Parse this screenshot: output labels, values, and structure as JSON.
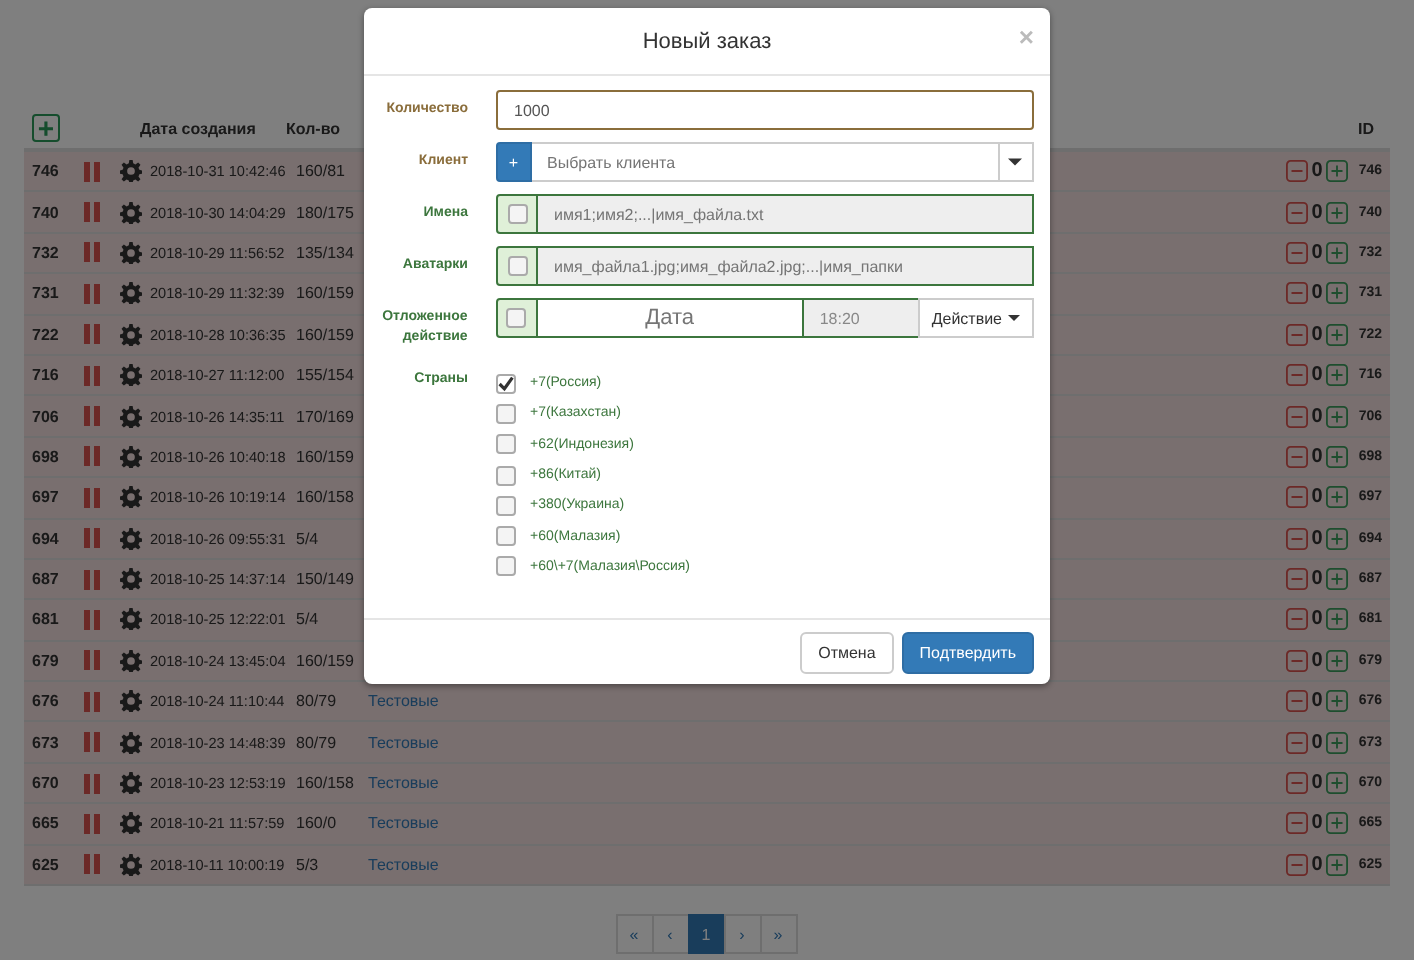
{
  "table": {
    "add_button": "+",
    "columns": [
      "Дата создания",
      "Кол-во",
      "ID"
    ],
    "rows": [
      {
        "number": "746",
        "date": "2018-10-31 10:42:46",
        "count": "160/81",
        "counter": "0",
        "id": "746"
      },
      {
        "number": "740",
        "date": "2018-10-30 14:04:29",
        "count": "180/175",
        "counter": "0",
        "id": "740"
      },
      {
        "number": "732",
        "date": "2018-10-29 11:56:52",
        "count": "135/134",
        "counter": "0",
        "id": "732"
      },
      {
        "number": "731",
        "date": "2018-10-29 11:32:39",
        "count": "160/159",
        "counter": "0",
        "id": "731"
      },
      {
        "number": "722",
        "date": "2018-10-28 10:36:35",
        "count": "160/159",
        "counter": "0",
        "id": "722"
      },
      {
        "number": "716",
        "date": "2018-10-27 11:12:00",
        "count": "155/154",
        "counter": "0",
        "id": "716"
      },
      {
        "number": "706",
        "date": "2018-10-26 14:35:11",
        "count": "170/169",
        "counter": "0",
        "id": "706"
      },
      {
        "number": "698",
        "date": "2018-10-26 10:40:18",
        "count": "160/159",
        "counter": "0",
        "id": "698"
      },
      {
        "number": "697",
        "date": "2018-10-26 10:19:14",
        "count": "160/158",
        "counter": "0",
        "id": "697"
      },
      {
        "number": "694",
        "date": "2018-10-26 09:55:31",
        "count": "5/4",
        "counter": "0",
        "id": "694"
      },
      {
        "number": "687",
        "date": "2018-10-25 14:37:14",
        "count": "150/149",
        "counter": "0",
        "id": "687"
      },
      {
        "number": "681",
        "date": "2018-10-25 12:22:01",
        "count": "5/4",
        "counter": "0",
        "id": "681"
      },
      {
        "number": "679",
        "date": "2018-10-24 13:45:04",
        "count": "160/159",
        "counter": "0",
        "id": "679"
      },
      {
        "number": "676",
        "date": "2018-10-24 11:10:44",
        "count": "80/79",
        "group": "Тестовые",
        "counter": "0",
        "id": "676"
      },
      {
        "number": "673",
        "date": "2018-10-23 14:48:39",
        "count": "80/79",
        "group": "Тестовые",
        "counter": "0",
        "id": "673"
      },
      {
        "number": "670",
        "date": "2018-10-23 12:53:19",
        "count": "160/158",
        "group": "Тестовые",
        "counter": "0",
        "id": "670"
      },
      {
        "number": "665",
        "date": "2018-10-21 11:57:59",
        "count": "160/0",
        "group": "Тестовые",
        "counter": "0",
        "id": "665"
      },
      {
        "number": "625",
        "date": "2018-10-11 10:00:19",
        "count": "5/3",
        "group": "Тестовые",
        "counter": "0",
        "id": "625"
      }
    ]
  },
  "pagination": [
    {
      "label": "«",
      "selected": false
    },
    {
      "label": "‹",
      "selected": false
    },
    {
      "label": "1",
      "selected": true
    },
    {
      "label": "›",
      "selected": false
    },
    {
      "label": "»",
      "selected": false
    }
  ],
  "modal": {
    "title": "Новый заказ",
    "close": "×",
    "fields": [
      {
        "kind": "text",
        "label": "Количество",
        "value": "1000"
      },
      {
        "kind": "client",
        "label": "Клиент",
        "button": "+",
        "placeholder": "Выбрать клиента"
      },
      {
        "kind": "check_input",
        "label": "Имена",
        "checked": false,
        "placeholder": "имя1;имя2;...|имя_файла.txt"
      },
      {
        "kind": "check_input",
        "label": "Аватарки",
        "checked": false,
        "placeholder": "имя_файла1.jpg;имя_файла2.jpg;...|имя_папки"
      },
      {
        "kind": "delayed",
        "label": "Отложенное действие",
        "checked": false,
        "date_placeholder": "Дата",
        "time": "18:20",
        "action": "Действие"
      },
      {
        "kind": "checklist",
        "label": "Страны",
        "options": [
          {
            "label": "+7(Россия)",
            "checked": true
          },
          {
            "label": "+7(Казахстан)",
            "checked": false
          },
          {
            "label": "+62(Индонезия)",
            "checked": false
          },
          {
            "label": "+86(Китай)",
            "checked": false
          },
          {
            "label": "+380(Украина)",
            "checked": false
          },
          {
            "label": "+60(Малазия)",
            "checked": false
          },
          {
            "label": "+60\\+7(Малазия\\Россия)",
            "checked": false
          }
        ]
      }
    ],
    "buttons": [
      {
        "label": "Отмена",
        "kind": "default"
      },
      {
        "label": "Подтвердить",
        "kind": "primary"
      }
    ]
  }
}
